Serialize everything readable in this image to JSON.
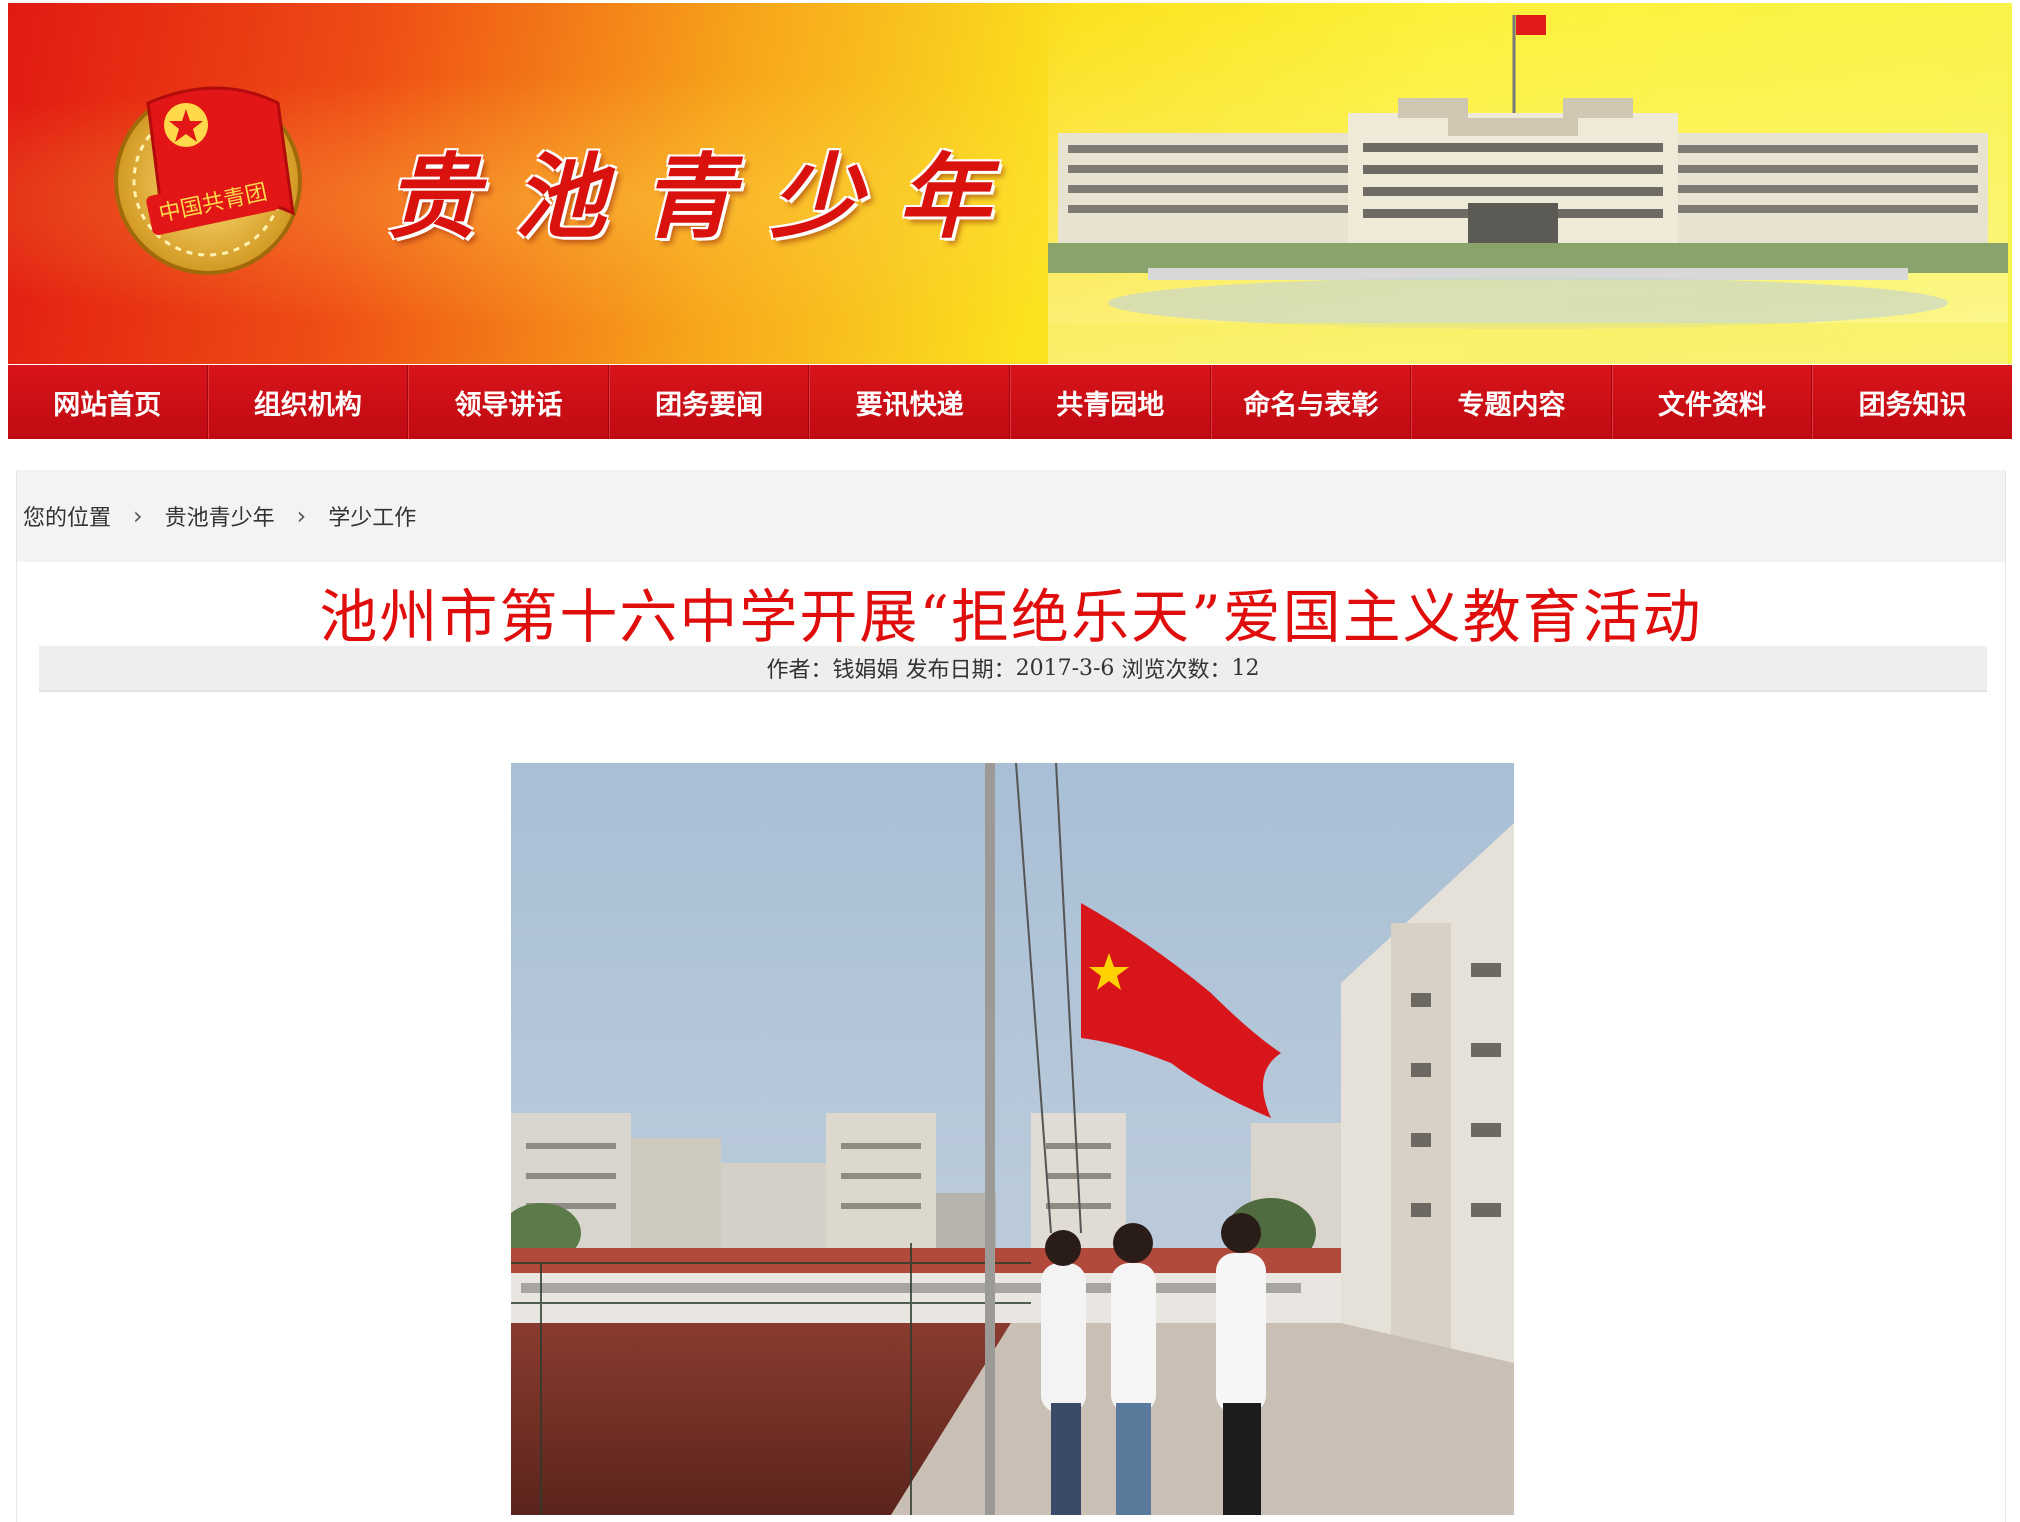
{
  "header": {
    "site_title": "贵池青少年",
    "emblem_text": "中国共青团"
  },
  "nav": {
    "items": [
      {
        "label": "网站首页"
      },
      {
        "label": "组织机构"
      },
      {
        "label": "领导讲话"
      },
      {
        "label": "团务要闻"
      },
      {
        "label": "要讯快递"
      },
      {
        "label": "共青园地"
      },
      {
        "label": "命名与表彰"
      },
      {
        "label": "专题内容"
      },
      {
        "label": "文件资料"
      },
      {
        "label": "团务知识"
      }
    ]
  },
  "breadcrumb": {
    "prefix": "您的位置",
    "separator": "›",
    "items": [
      "贵池青少年",
      "学少工作"
    ]
  },
  "article": {
    "title": "池州市第十六中学开展“拒绝乐天”爱国主义教育活动",
    "meta": {
      "author_label": "作者：",
      "author": "钱娟娟",
      "date_label": "发布日期：",
      "date": "2017-3-6",
      "views_label": "浏览次数：",
      "views": "12"
    }
  },
  "colors": {
    "nav_red": "#c8101a",
    "title_red": "#e00d0d",
    "banner_yellow": "#fbe21f"
  }
}
